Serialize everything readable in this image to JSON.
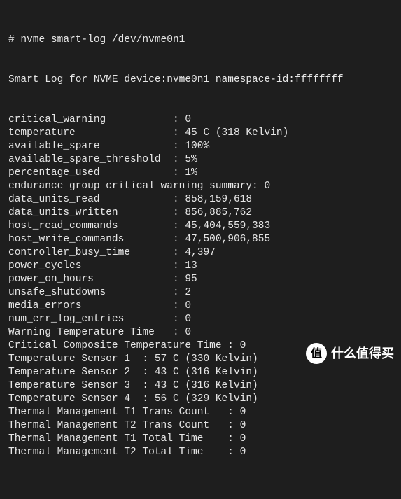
{
  "command_line": "# nvme smart-log /dev/nvme0n1",
  "header": "Smart Log for NVME device:nvme0n1 namespace-id:ffffffff",
  "rows": [
    {
      "label": "critical_warning",
      "pad": 27,
      "sep": ": ",
      "value": "0"
    },
    {
      "label": "temperature",
      "pad": 27,
      "sep": ": ",
      "value": "45 C (318 Kelvin)"
    },
    {
      "label": "available_spare",
      "pad": 27,
      "sep": ": ",
      "value": "100%"
    },
    {
      "label": "available_spare_threshold",
      "pad": 27,
      "sep": ": ",
      "value": "5%"
    },
    {
      "label": "percentage_used",
      "pad": 27,
      "sep": ": ",
      "value": "1%"
    },
    {
      "label": "endurance group critical warning summary",
      "pad": 0,
      "sep": ": ",
      "value": "0"
    },
    {
      "label": "data_units_read",
      "pad": 27,
      "sep": ": ",
      "value": "858,159,618"
    },
    {
      "label": "data_units_written",
      "pad": 27,
      "sep": ": ",
      "value": "856,885,762"
    },
    {
      "label": "host_read_commands",
      "pad": 27,
      "sep": ": ",
      "value": "45,404,559,383"
    },
    {
      "label": "host_write_commands",
      "pad": 27,
      "sep": ": ",
      "value": "47,500,906,855"
    },
    {
      "label": "controller_busy_time",
      "pad": 27,
      "sep": ": ",
      "value": "4,397"
    },
    {
      "label": "power_cycles",
      "pad": 27,
      "sep": ": ",
      "value": "13"
    },
    {
      "label": "power_on_hours",
      "pad": 27,
      "sep": ": ",
      "value": "95"
    },
    {
      "label": "unsafe_shutdowns",
      "pad": 27,
      "sep": ": ",
      "value": "2"
    },
    {
      "label": "media_errors",
      "pad": 27,
      "sep": ": ",
      "value": "0"
    },
    {
      "label": "num_err_log_entries",
      "pad": 27,
      "sep": ": ",
      "value": "0"
    },
    {
      "label": "Warning Temperature Time",
      "pad": 27,
      "sep": ": ",
      "value": "0"
    },
    {
      "label": "Critical Composite Temperature Time",
      "pad": 0,
      "sep": " : ",
      "value": "0"
    },
    {
      "label": "Temperature Sensor 1",
      "pad": 22,
      "sep": ": ",
      "value": "57 C (330 Kelvin)"
    },
    {
      "label": "Temperature Sensor 2",
      "pad": 22,
      "sep": ": ",
      "value": "43 C (316 Kelvin)"
    },
    {
      "label": "Temperature Sensor 3",
      "pad": 22,
      "sep": ": ",
      "value": "43 C (316 Kelvin)"
    },
    {
      "label": "Temperature Sensor 4",
      "pad": 22,
      "sep": ": ",
      "value": "56 C (329 Kelvin)"
    },
    {
      "label": "Thermal Management T1 Trans Count",
      "pad": 0,
      "sep": "   : ",
      "value": "0"
    },
    {
      "label": "Thermal Management T2 Trans Count",
      "pad": 0,
      "sep": "   : ",
      "value": "0"
    },
    {
      "label": "Thermal Management T1 Total Time",
      "pad": 0,
      "sep": "    : ",
      "value": "0"
    },
    {
      "label": "Thermal Management T2 Total Time",
      "pad": 0,
      "sep": "    : ",
      "value": "0"
    }
  ],
  "watermark": {
    "icon": "值",
    "text": "什么值得买"
  }
}
